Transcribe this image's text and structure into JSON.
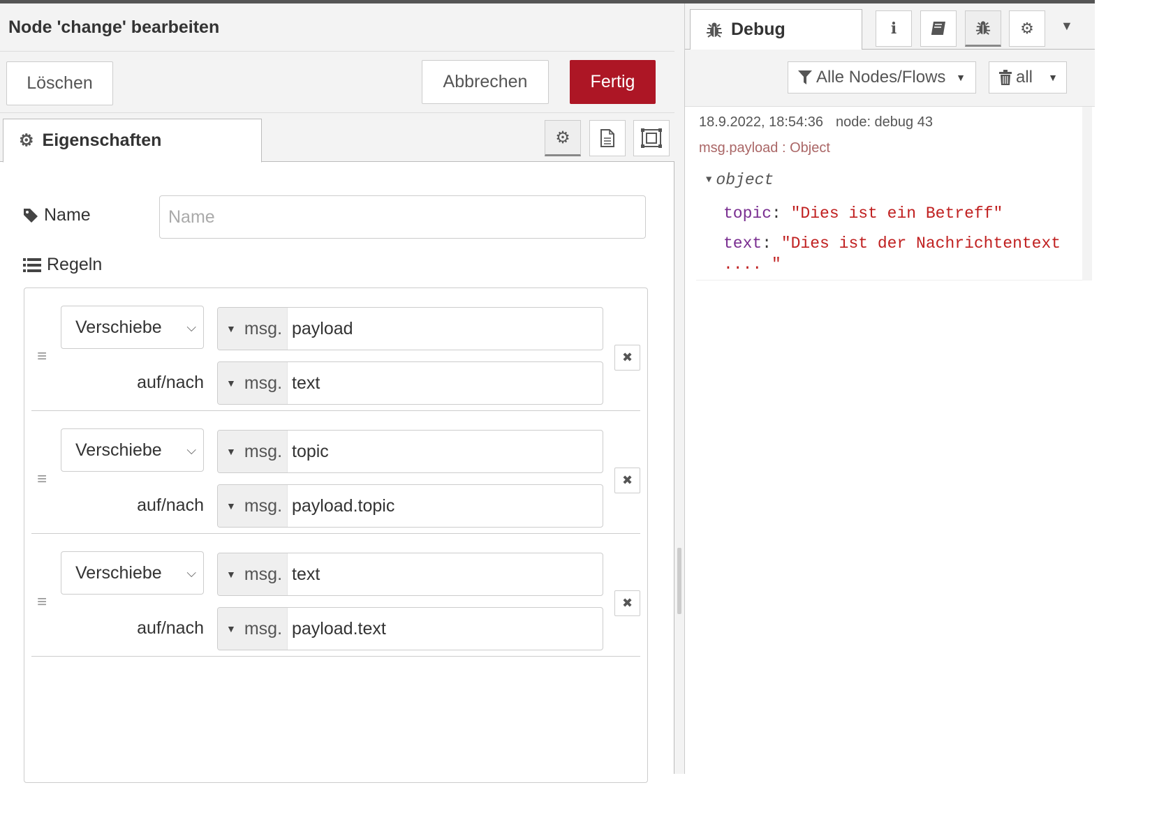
{
  "editor": {
    "title": "Node 'change' bearbeiten",
    "buttons": {
      "delete": "Löschen",
      "cancel": "Abbrechen",
      "done": "Fertig"
    },
    "tab_properties": "Eigenschaften",
    "name_label": "Name",
    "name_placeholder": "Name",
    "name_value": "",
    "rules_label": "Regeln",
    "rules": [
      {
        "action": "Verschiebe",
        "from_type": "msg.",
        "from_value": "payload",
        "to_label": "auf/nach",
        "to_type": "msg.",
        "to_value": "text"
      },
      {
        "action": "Verschiebe",
        "from_type": "msg.",
        "from_value": "topic",
        "to_label": "auf/nach",
        "to_type": "msg.",
        "to_value": "payload.topic"
      },
      {
        "action": "Verschiebe",
        "from_type": "msg.",
        "from_value": "text",
        "to_label": "auf/nach",
        "to_type": "msg.",
        "to_value": "payload.text"
      }
    ]
  },
  "sidebar": {
    "tab_debug": "Debug",
    "filter_label": "Alle Nodes/Flows",
    "clear_label": "all",
    "message": {
      "timestamp": "18.9.2022, 18:54:36",
      "node": "node: debug 43",
      "topic": "msg.payload : Object",
      "object_label": "object",
      "props": [
        {
          "key": "topic",
          "value": "\"Dies ist ein Betreff\""
        },
        {
          "key": "text",
          "value": "\"Dies ist der Nachrichtentext .... \""
        }
      ]
    }
  },
  "colors": {
    "primary": "#ad1625",
    "debug_key": "#792e90",
    "debug_string": "#c02020",
    "debug_topic": "#aa6666"
  },
  "icons": [
    "gear-icon",
    "tag-icon",
    "list-icon",
    "bug-icon",
    "info-icon",
    "book-icon",
    "filter-icon",
    "trash-icon",
    "drag-handle-icon",
    "close-icon",
    "chevron-down-icon"
  ]
}
